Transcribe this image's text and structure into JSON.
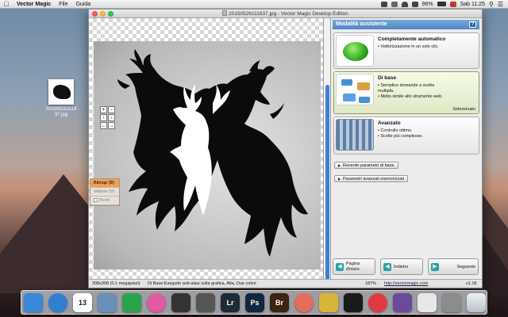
{
  "menubar": {
    "app_name": "Vector Magic",
    "menus": [
      "File",
      "Guida"
    ],
    "battery": "96%",
    "clock": "Sab 11:25"
  },
  "desktop_file": {
    "name": "20150525111837.jpg",
    "name_line1": "201505251118",
    "name_line2": "37.jpg"
  },
  "window": {
    "title": "20150526111837.jpg - Vector Magic Desktop Edition"
  },
  "modes": [
    {
      "label": "Bitmap (B)",
      "selected": true
    },
    {
      "label": "Vettore (V)",
      "selected": false
    },
    {
      "label": "Bordi",
      "checkbox": true
    }
  ],
  "zoom_buttons": [
    "+",
    "-",
    "↑",
    "↓",
    "←",
    "→"
  ],
  "status": {
    "dimensions": "308x308 (0.1 megapixel)",
    "summary": "Di Base:Eseguito anti-alias sulla grafica, Alta, Due colori",
    "zoom": "187%",
    "url": "http://vectormagic.com",
    "version": "v1.18"
  },
  "panel": {
    "title": "Modalità assistente",
    "help": "?",
    "cards": [
      {
        "title": "Completamente automatico",
        "lines": [
          "• Vettorizzazione in un solo clic."
        ]
      },
      {
        "title": "Di base",
        "lines": [
          "• Semplice domande a scelta",
          "  multipla.",
          "• Molto simile allo strumento web."
        ],
        "note": "Selezionato"
      },
      {
        "title": "Avanzato",
        "lines": [
          "• Controllo ottimo.",
          "• Scelte più complesse."
        ]
      }
    ],
    "recent_button": "Recente parametri di base",
    "saved_button": "Parametri avanzati memorizzati",
    "nav": {
      "home": [
        "Pagina",
        "d'inizio"
      ],
      "back": "Indietro",
      "next": "Seguente"
    }
  },
  "dock": {
    "items": [
      {
        "name": "finder",
        "label": "",
        "color": "#3a86d8"
      },
      {
        "name": "safari",
        "label": "",
        "color": "#2f7fd3"
      },
      {
        "name": "calendar",
        "label": "13",
        "color": "#ffffff"
      },
      {
        "name": "preview",
        "label": "",
        "color": "#6a8fb8"
      },
      {
        "name": "evernote",
        "label": "",
        "color": "#2aa34a"
      },
      {
        "name": "photos",
        "label": "",
        "color": "#e25aa0"
      },
      {
        "name": "fcp",
        "label": "",
        "color": "#333"
      },
      {
        "name": "camera",
        "label": "",
        "color": "#555"
      },
      {
        "name": "lightroom",
        "label": "Lr",
        "color": "#1c2b36"
      },
      {
        "name": "photoshop",
        "label": "Ps",
        "color": "#0f2740"
      },
      {
        "name": "bridge",
        "label": "Br",
        "color": "#3b2410"
      },
      {
        "name": "iphoto",
        "label": "",
        "color": "#e46c5a"
      },
      {
        "name": "notes",
        "label": "",
        "color": "#d9b43a"
      },
      {
        "name": "vectormagic",
        "label": "",
        "color": "#1a1a1a"
      },
      {
        "name": "music",
        "label": "",
        "color": "#e03a45"
      },
      {
        "name": "imovie",
        "label": "",
        "color": "#6b4a9a"
      },
      {
        "name": "installer",
        "label": "",
        "color": "#e8e8e8"
      },
      {
        "name": "other",
        "label": "",
        "color": "#8c8c8c"
      },
      {
        "name": "trash",
        "label": "",
        "color": "#cfd5da"
      }
    ]
  }
}
